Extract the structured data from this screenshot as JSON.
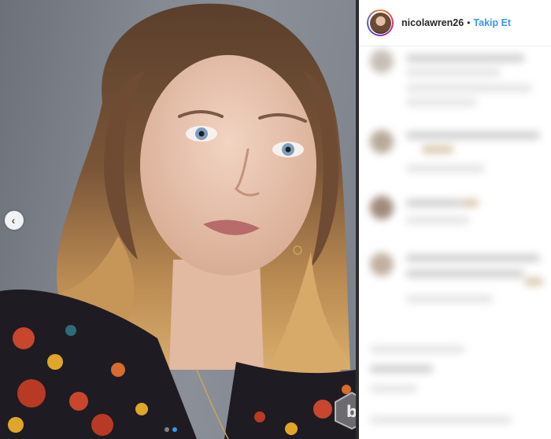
{
  "post": {
    "username": "nicolawren26",
    "separator": "•",
    "follow_label": "Takip Et"
  },
  "carousel": {
    "current_slide": 2,
    "total_slides": 2,
    "prev_glyph": "‹"
  },
  "icons": [
    "chevron-left-icon",
    "avatar",
    "watermark-logo"
  ],
  "colors": {
    "follow_blue": "#3897f0",
    "divider": "#2d2d2d",
    "photo_background": "#858a93"
  }
}
